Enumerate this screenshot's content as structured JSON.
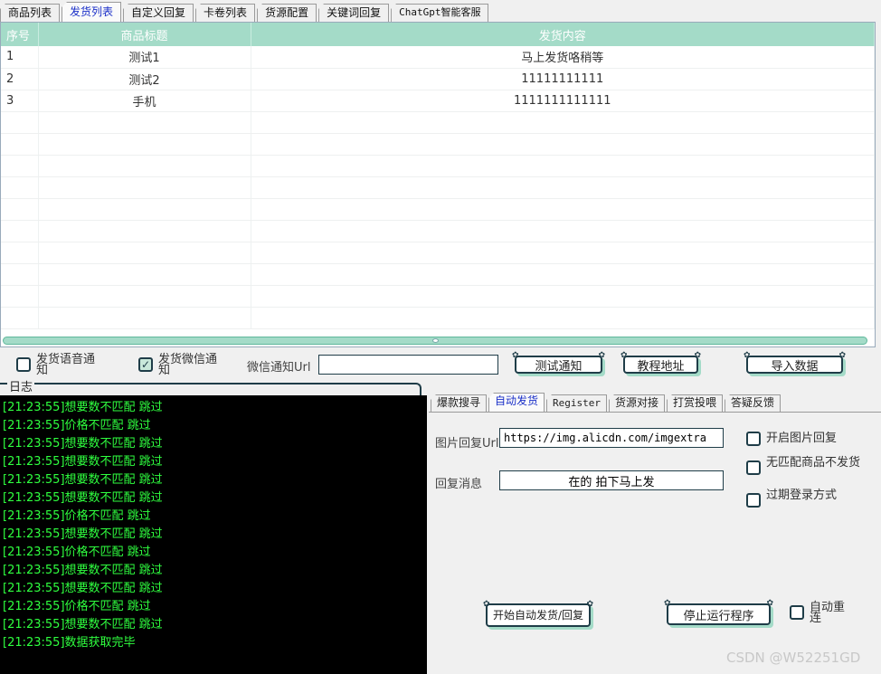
{
  "top_tabs": [
    {
      "label": "商品列表"
    },
    {
      "label": "发货列表"
    },
    {
      "label": "自定义回复"
    },
    {
      "label": "卡卷列表"
    },
    {
      "label": "货源配置"
    },
    {
      "label": "关键词回复"
    },
    {
      "label": "ChatGpt智能客服"
    }
  ],
  "grid": {
    "headers": [
      "序号",
      "商品标题",
      "发货内容"
    ],
    "rows": [
      [
        "1",
        "测试1",
        "马上发货咯稍等"
      ],
      [
        "2",
        "测试2",
        "11111111111"
      ],
      [
        "3",
        "手机",
        "1111111111111"
      ]
    ]
  },
  "options": {
    "sms_notify": "发货语音通知",
    "wechat_notify": "发货微信通知",
    "wechat_url_label": "微信通知Url",
    "wechat_url_value": "",
    "test_notify_button": "测试通知",
    "tutorial_button": "教程地址",
    "import_button": "导入数据"
  },
  "log": {
    "title": "日志",
    "lines": [
      "[21:23:55]想要数不匹配 跳过",
      "[21:23:55]价格不匹配 跳过",
      "[21:23:55]想要数不匹配 跳过",
      "[21:23:55]想要数不匹配 跳过",
      "[21:23:55]想要数不匹配 跳过",
      "[21:23:55]想要数不匹配 跳过",
      "[21:23:55]价格不匹配 跳过",
      "[21:23:55]想要数不匹配 跳过",
      "[21:23:55]价格不匹配 跳过",
      "[21:23:55]想要数不匹配 跳过",
      "[21:23:55]想要数不匹配 跳过",
      "[21:23:55]价格不匹配 跳过",
      "[21:23:55]想要数不匹配 跳过",
      "[21:23:55]数据获取完毕"
    ]
  },
  "right_tabs": [
    {
      "label": "爆款搜寻"
    },
    {
      "label": "自动发货"
    },
    {
      "label": "Register"
    },
    {
      "label": "货源对接"
    },
    {
      "label": "打赏投喂"
    },
    {
      "label": "答疑反馈"
    }
  ],
  "auto_ship": {
    "image_url_label": "图片回复Url",
    "image_url_value": "https://img.alicdn.com/imgextra",
    "reply_label": "回复消息",
    "reply_value": "在的 拍下马上发",
    "enable_image_reply": "开启图片回复",
    "no_match_no_ship": "无匹配商品不发货",
    "expired_login": "过期登录方式",
    "start_button": "开始自动发货/回复",
    "stop_button": "停止运行程序",
    "auto_reconnect": "自动重连"
  },
  "watermark": "CSDN @W52251GD"
}
